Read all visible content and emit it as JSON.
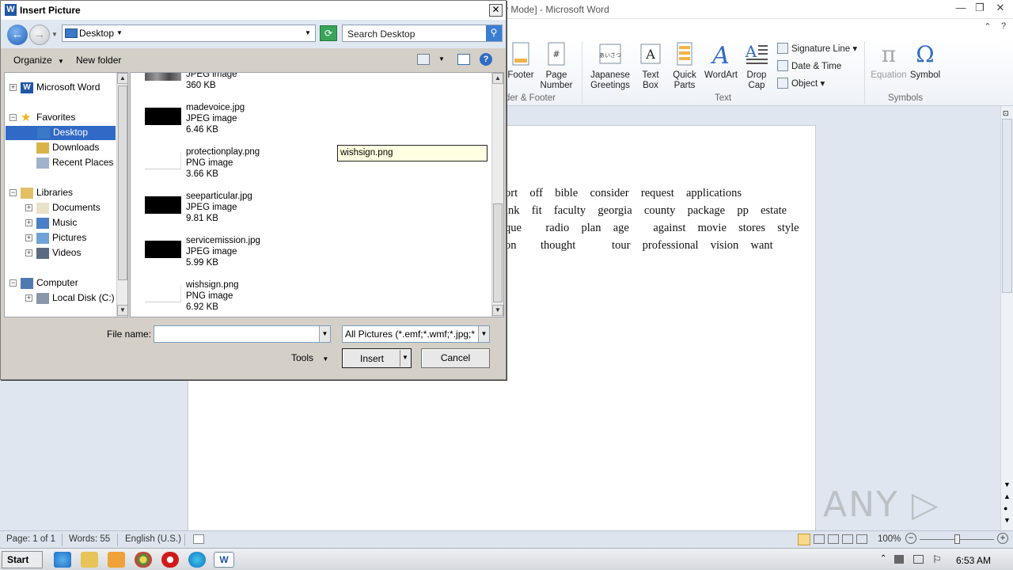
{
  "word": {
    "title": "y Mode] - Microsoft Word",
    "ribbon": {
      "buttons": [
        {
          "label": "Footer"
        },
        {
          "label": "Page\nNumber"
        },
        {
          "label": "Japanese\nGreetings"
        },
        {
          "label": "Text\nBox"
        },
        {
          "label": "Quick\nParts"
        },
        {
          "label": "WordArt"
        },
        {
          "label": "Drop\nCap"
        },
        {
          "label": "Equation"
        },
        {
          "label": "Symbol"
        }
      ],
      "small_buttons": [
        "Signature Line",
        "Date & Time",
        "Object"
      ],
      "groups": [
        "der & Footer",
        "Text",
        "Symbols"
      ],
      "greeting_icon_text": "あいさつ"
    },
    "document_lines": [
      "ort  off  bible  consider  request  applications",
      "ink  fit  faculty  georgia  county  package  pp  estate",
      "que    radio  plan  age    against  movie  stores  style",
      "on    thought      tour  professional  vision  want"
    ],
    "status": {
      "page": "Page: 1 of 1",
      "words": "Words: 55",
      "language": "English (U.S.)",
      "zoom": "100%"
    },
    "watermark": "ANY ▷ RUN"
  },
  "taskbar": {
    "start": "Start",
    "clock": "6:53 AM"
  },
  "dialog": {
    "title": "Insert Picture",
    "address": "Desktop",
    "search_placeholder": "Search Desktop",
    "toolbar": {
      "organize": "Organize",
      "new_folder": "New folder"
    },
    "tree": [
      {
        "label": "Microsoft Word",
        "icon": "word-icon",
        "level": 0,
        "expander": "+"
      },
      {
        "label": "Favorites",
        "icon": "star-icon",
        "level": 0,
        "expander": "−"
      },
      {
        "label": "Desktop",
        "icon": "desktop-icon",
        "level": 1,
        "selected": true
      },
      {
        "label": "Downloads",
        "icon": "downloads-icon",
        "level": 1
      },
      {
        "label": "Recent Places",
        "icon": "recent-places-icon",
        "level": 1
      },
      {
        "label": "Libraries",
        "icon": "libraries-icon",
        "level": 0,
        "expander": "−"
      },
      {
        "label": "Documents",
        "icon": "documents-icon",
        "level": 1,
        "expander": "+"
      },
      {
        "label": "Music",
        "icon": "music-icon",
        "level": 1,
        "expander": "+"
      },
      {
        "label": "Pictures",
        "icon": "pictures-icon",
        "level": 1,
        "expander": "+"
      },
      {
        "label": "Videos",
        "icon": "videos-icon",
        "level": 1,
        "expander": "+"
      },
      {
        "label": "Computer",
        "icon": "computer-icon",
        "level": 0,
        "expander": "−"
      },
      {
        "label": "Local Disk (C:)",
        "icon": "disk-icon",
        "level": 1,
        "expander": "+"
      }
    ],
    "files": [
      {
        "name": "",
        "type": "JPEG image",
        "size": "360 KB",
        "thumb": "photo"
      },
      {
        "name": "madevoice.jpg",
        "type": "JPEG image",
        "size": "6.46 KB",
        "thumb": "black"
      },
      {
        "name": "protectionplay.png",
        "type": "PNG image",
        "size": "3.66 KB",
        "thumb": "white"
      },
      {
        "name": "seeparticular.jpg",
        "type": "JPEG image",
        "size": "9.81 KB",
        "thumb": "black"
      },
      {
        "name": "servicemission.jpg",
        "type": "JPEG image",
        "size": "5.99 KB",
        "thumb": "black"
      },
      {
        "name": "wishsign.png",
        "type": "PNG image",
        "size": "6.92 KB",
        "thumb": "white"
      }
    ],
    "tooltip": "wishsign.png",
    "file_name_label": "File name:",
    "file_name_value": "",
    "filter": "All Pictures (*.emf;*.wmf;*.jpg;*",
    "tools": "Tools",
    "insert": "Insert",
    "cancel": "Cancel"
  }
}
